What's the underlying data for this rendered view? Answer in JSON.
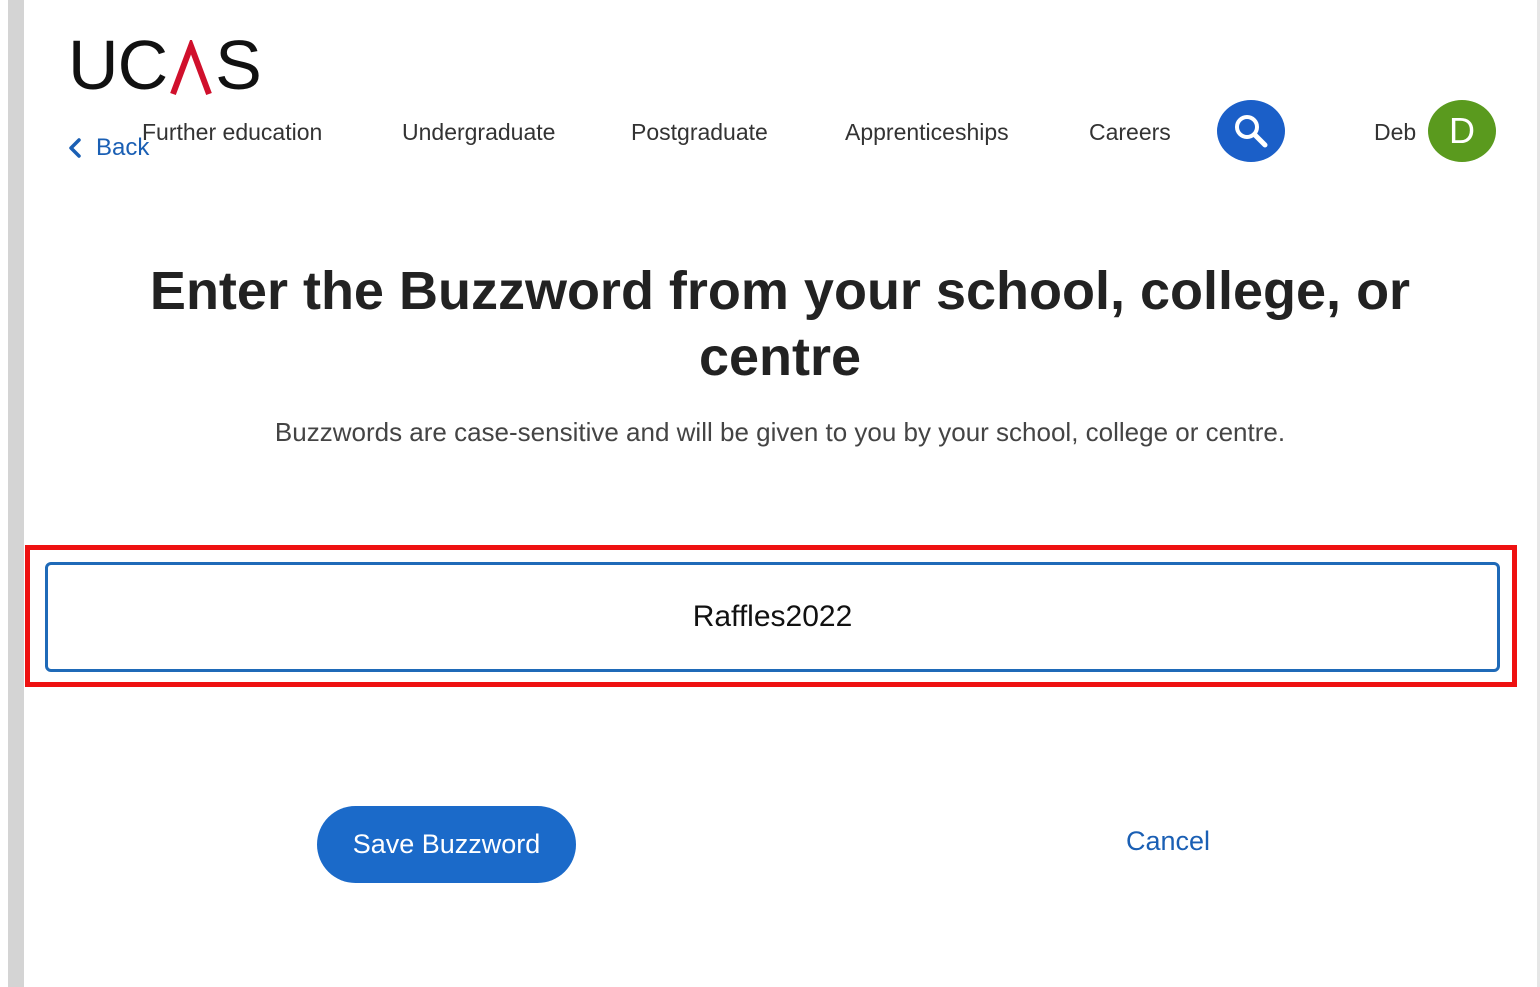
{
  "header": {
    "logo_text": "UCAS",
    "back_label": "Back",
    "nav_items": [
      "Further education",
      "Undergraduate",
      "Postgraduate",
      "Apprenticeships",
      "Careers"
    ],
    "user_name": "Deb",
    "avatar_initial": "D"
  },
  "main": {
    "title": "Enter the Buzzword from your school, college, or centre",
    "hint": "Buzzwords are case-sensitive and will be given to you by your school, college or centre.",
    "buzzword_value": "Raffles2022",
    "save_label": "Save Buzzword",
    "cancel_label": "Cancel"
  },
  "colors": {
    "accent_blue": "#1b6ac9",
    "avatar_green": "#5a9a1e",
    "logo_red": "#d0102c",
    "highlight_red": "#ee1111"
  },
  "icons": [
    "chevron-left-icon",
    "search-icon"
  ]
}
